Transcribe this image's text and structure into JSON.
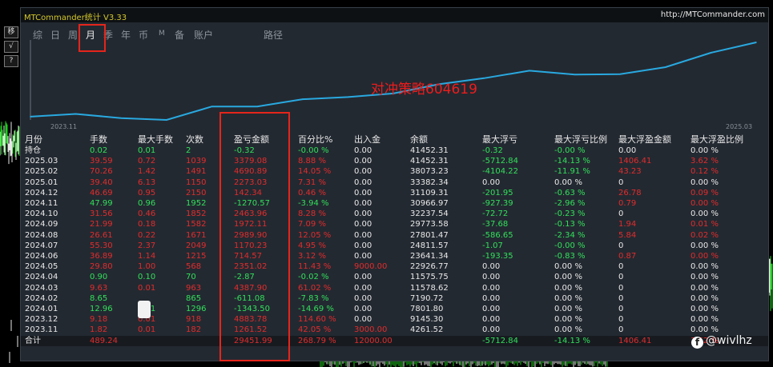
{
  "app": {
    "title": "MTCommander统计 V3.33",
    "url": "http://MTCommander.com"
  },
  "toolbar_left": [
    {
      "name": "move-tool",
      "label": "移"
    },
    {
      "name": "check-tool",
      "label": "√"
    },
    {
      "name": "help-tool",
      "label": "?"
    }
  ],
  "tabs": [
    {
      "label": "综",
      "active": false
    },
    {
      "label": "日",
      "active": false
    },
    {
      "label": "周",
      "active": false
    },
    {
      "label": "月",
      "active": true
    },
    {
      "label": "季",
      "active": false
    },
    {
      "label": "年",
      "active": false
    },
    {
      "label": "币",
      "active": false
    },
    {
      "label": "M",
      "active": false
    },
    {
      "label": "备",
      "active": false
    },
    {
      "label": "账户",
      "active": false
    },
    {
      "label": "路径",
      "active": false
    }
  ],
  "chart_data": {
    "type": "line",
    "x": [
      "2023.11",
      "2023.12",
      "2024.01",
      "2024.02",
      "2024.03",
      "2024.04",
      "2024.05",
      "2024.06",
      "2024.07",
      "2024.08",
      "2024.09",
      "2024.10",
      "2024.11",
      "2024.12",
      "2025.01",
      "2025.02",
      "2025.03"
    ],
    "y": [
      1261.52,
      2145.3,
      801.8,
      190.72,
      4578.62,
      4575.75,
      6926.77,
      7641.34,
      8811.07,
      11801.47,
      13773.58,
      16237.54,
      14966.97,
      15109.31,
      17382.34,
      22073.23,
      25452.31
    ],
    "x_tick_labels": [
      "2023.11",
      "2025.03"
    ],
    "color": "#29a9e0",
    "grid": false
  },
  "annotation": "对冲策略604619",
  "table": {
    "headers": [
      "月份",
      "手数",
      "最大手数",
      "次数",
      "盈亏金额",
      "百分比%",
      "出入金",
      "余额",
      "最大浮亏",
      "最大浮亏比例",
      "最大浮盈金额",
      "最大浮盈比例"
    ],
    "rows": [
      {
        "cells": [
          "持仓",
          "0.02",
          "0.01",
          "2",
          "-0.32",
          "-0.00 %",
          "0.00",
          "41452.31",
          "-0.32",
          "-0.00 %",
          "0.00",
          "0.00 %"
        ],
        "colors": [
          "w",
          "g",
          "g",
          "g",
          "g",
          "g",
          "w",
          "w",
          "g",
          "g",
          "w",
          "w"
        ]
      },
      {
        "cells": [
          "2025.03",
          "39.59",
          "0.72",
          "1039",
          "3379.08",
          "8.88 %",
          "0.00",
          "41452.31",
          "-5712.84",
          "-14.13 %",
          "1406.41",
          "3.62 %"
        ],
        "colors": [
          "w",
          "r",
          "r",
          "r",
          "r",
          "r",
          "w",
          "w",
          "g",
          "g",
          "r",
          "r"
        ]
      },
      {
        "cells": [
          "2025.02",
          "70.26",
          "1.42",
          "1491",
          "4690.89",
          "14.05 %",
          "0.00",
          "38073.23",
          "-4104.22",
          "-11.91 %",
          "43.23",
          "0.12 %"
        ],
        "colors": [
          "w",
          "r",
          "r",
          "r",
          "r",
          "r",
          "w",
          "w",
          "g",
          "g",
          "r",
          "r"
        ]
      },
      {
        "cells": [
          "2025.01",
          "39.40",
          "6.13",
          "1150",
          "2273.03",
          "7.31 %",
          "0.00",
          "33382.34",
          "0.00",
          "0.00 %",
          "0",
          "0.00 %"
        ],
        "colors": [
          "w",
          "r",
          "r",
          "r",
          "r",
          "r",
          "w",
          "w",
          "w",
          "w",
          "w",
          "w"
        ]
      },
      {
        "cells": [
          "2024.12",
          "46.69",
          "0.95",
          "2150",
          "142.34",
          "0.46 %",
          "0.00",
          "31109.31",
          "-201.95",
          "-0.63 %",
          "26.78",
          "0.09 %"
        ],
        "colors": [
          "w",
          "r",
          "r",
          "r",
          "r",
          "r",
          "w",
          "w",
          "g",
          "g",
          "r",
          "r"
        ]
      },
      {
        "cells": [
          "2024.11",
          "47.99",
          "0.96",
          "1952",
          "-1270.57",
          "-3.94 %",
          "0.00",
          "30966.97",
          "-927.39",
          "-2.96 %",
          "0.79",
          "0.00 %"
        ],
        "colors": [
          "w",
          "g",
          "g",
          "g",
          "g",
          "g",
          "w",
          "w",
          "g",
          "g",
          "r",
          "r"
        ]
      },
      {
        "cells": [
          "2024.10",
          "31.56",
          "0.46",
          "1852",
          "2463.96",
          "8.28 %",
          "0.00",
          "32237.54",
          "-72.72",
          "-0.23 %",
          "0",
          "0.00 %"
        ],
        "colors": [
          "w",
          "r",
          "r",
          "r",
          "r",
          "r",
          "w",
          "w",
          "g",
          "g",
          "w",
          "w"
        ]
      },
      {
        "cells": [
          "2024.09",
          "21.99",
          "0.18",
          "1582",
          "1972.11",
          "7.09 %",
          "0.00",
          "29773.58",
          "-37.68",
          "-0.13 %",
          "1.94",
          "0.01 %"
        ],
        "colors": [
          "w",
          "r",
          "r",
          "r",
          "r",
          "r",
          "w",
          "w",
          "g",
          "g",
          "r",
          "r"
        ]
      },
      {
        "cells": [
          "2024.08",
          "26.61",
          "0.22",
          "1671",
          "2989.90",
          "12.05 %",
          "0.00",
          "27801.47",
          "-586.65",
          "-2.34 %",
          "5.84",
          "0.02 %"
        ],
        "colors": [
          "w",
          "r",
          "r",
          "r",
          "r",
          "r",
          "w",
          "w",
          "g",
          "g",
          "r",
          "r"
        ]
      },
      {
        "cells": [
          "2024.07",
          "55.30",
          "2.37",
          "2049",
          "1170.23",
          "4.95 %",
          "0.00",
          "24811.57",
          "-1.07",
          "-0.00 %",
          "0",
          "0.00 %"
        ],
        "colors": [
          "w",
          "r",
          "r",
          "r",
          "r",
          "r",
          "w",
          "w",
          "g",
          "g",
          "w",
          "w"
        ]
      },
      {
        "cells": [
          "2024.06",
          "36.89",
          "1.14",
          "1215",
          "714.57",
          "3.12 %",
          "0.00",
          "23641.34",
          "-193.35",
          "-0.83 %",
          "0.87",
          "0.00 %"
        ],
        "colors": [
          "w",
          "r",
          "r",
          "r",
          "r",
          "r",
          "w",
          "w",
          "g",
          "g",
          "r",
          "r"
        ]
      },
      {
        "cells": [
          "2024.05",
          "29.80",
          "1.00",
          "568",
          "2351.02",
          "11.43 %",
          "9000.00",
          "22926.77",
          "0.00",
          "0.00 %",
          "0",
          "0.00 %"
        ],
        "colors": [
          "w",
          "r",
          "r",
          "r",
          "r",
          "r",
          "r",
          "w",
          "w",
          "w",
          "w",
          "w"
        ]
      },
      {
        "cells": [
          "2024.04",
          "0.90",
          "0.10",
          "70",
          "-2.87",
          "-0.02 %",
          "0.00",
          "11575.75",
          "0.00",
          "0.00 %",
          "0",
          "0.00 %"
        ],
        "colors": [
          "w",
          "g",
          "g",
          "g",
          "g",
          "g",
          "w",
          "w",
          "w",
          "w",
          "w",
          "w"
        ]
      },
      {
        "cells": [
          "2024.03",
          "9.63",
          "0.01",
          "963",
          "4387.90",
          "61.02 %",
          "0.00",
          "11578.62",
          "0.00",
          "0.00 %",
          "0",
          "0.00 %"
        ],
        "colors": [
          "w",
          "r",
          "r",
          "r",
          "r",
          "r",
          "w",
          "w",
          "w",
          "w",
          "w",
          "w"
        ]
      },
      {
        "cells": [
          "2024.02",
          "8.65",
          "",
          "865",
          "-611.08",
          "-7.83 %",
          "0.00",
          "7190.72",
          "0.00",
          "0.00 %",
          "0",
          "0.00 %"
        ],
        "colors": [
          "w",
          "g",
          "g",
          "g",
          "g",
          "g",
          "w",
          "w",
          "w",
          "w",
          "w",
          "w"
        ]
      },
      {
        "cells": [
          "2024.01",
          "12.96",
          "0.01",
          "1296",
          "-1343.50",
          "-14.69 %",
          "0.00",
          "7801.80",
          "0.00",
          "0.00 %",
          "0",
          "0.00 %"
        ],
        "colors": [
          "w",
          "g",
          "g",
          "g",
          "g",
          "g",
          "w",
          "w",
          "w",
          "w",
          "w",
          "w"
        ]
      },
      {
        "cells": [
          "2023.12",
          "9.18",
          "0.01",
          "918",
          "4883.78",
          "114.60 %",
          "0.00",
          "9145.30",
          "0.00",
          "0.00 %",
          "0",
          "0.00 %"
        ],
        "colors": [
          "w",
          "r",
          "r",
          "r",
          "r",
          "r",
          "w",
          "w",
          "w",
          "w",
          "w",
          "w"
        ]
      },
      {
        "cells": [
          "2023.11",
          "1.82",
          "0.01",
          "182",
          "1261.52",
          "42.05 %",
          "3000.00",
          "4261.52",
          "0.00",
          "0.00 %",
          "0",
          "0.00 %"
        ],
        "colors": [
          "w",
          "r",
          "r",
          "r",
          "r",
          "r",
          "r",
          "w",
          "w",
          "w",
          "w",
          "w"
        ]
      }
    ],
    "total": {
      "cells": [
        "合计",
        "489.24",
        "",
        "",
        "29451.99",
        "268.79 %",
        "12000.00",
        "",
        "-5712.84",
        "-14.13 %",
        "1406.41",
        "3.62 %"
      ],
      "colors": [
        "w",
        "r",
        "w",
        "w",
        "r",
        "r",
        "r",
        "w",
        "g",
        "g",
        "r",
        "r"
      ]
    }
  },
  "watermark": "@wivlhz",
  "watermark_icon": "facebook-icon"
}
